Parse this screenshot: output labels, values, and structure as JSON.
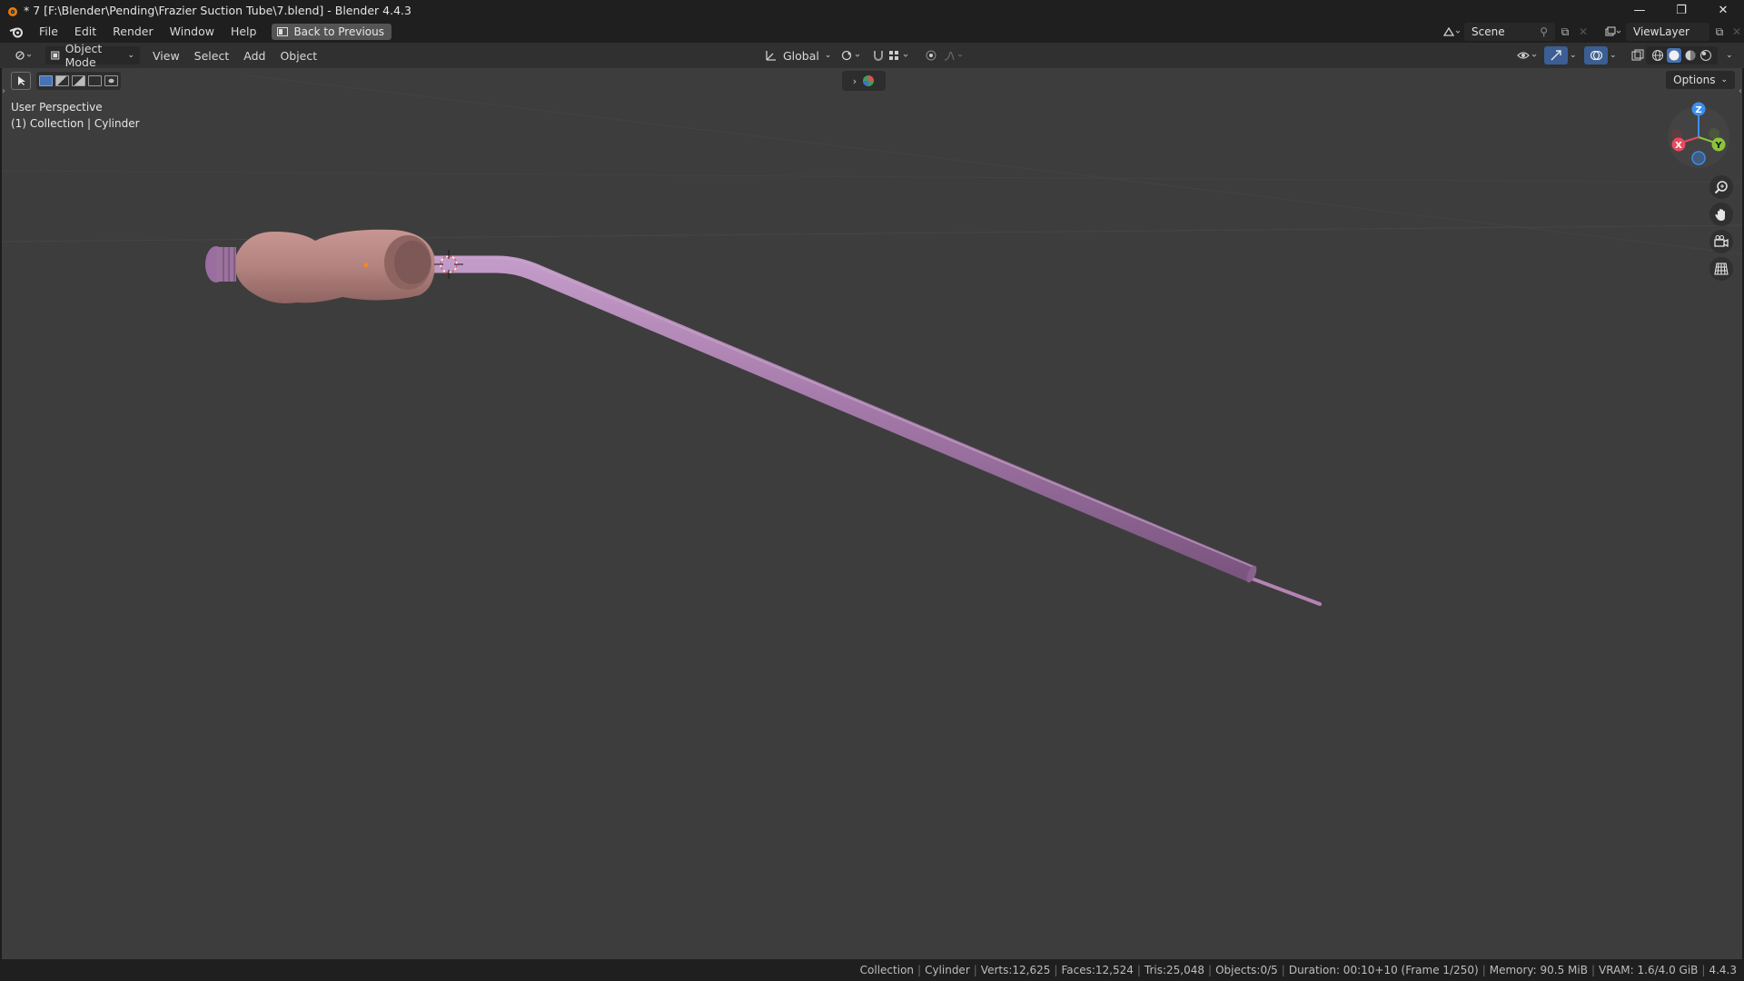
{
  "window": {
    "title": "* 7 [F:\\Blender\\Pending\\Frazier Suction Tube\\7.blend] - Blender 4.4.3",
    "controls": [
      "—",
      "❐",
      "✕"
    ]
  },
  "menubar": {
    "items": [
      "File",
      "Edit",
      "Render",
      "Window",
      "Help"
    ],
    "back_button": "Back to Previous",
    "scene_name": "Scene",
    "view_layer": "ViewLayer"
  },
  "header": {
    "mode": "Object Mode",
    "menus": [
      "View",
      "Select",
      "Add",
      "Object"
    ],
    "transform_orientation": "Global"
  },
  "viewport": {
    "perspective_label": "User Perspective",
    "collection_label": "(1) Collection | Cylinder",
    "options_label": "Options",
    "gizmo_axes": {
      "x": "X",
      "y": "Y",
      "z": "Z"
    },
    "colors": {
      "background": "#3d3d3d",
      "tube": "#a17aa6",
      "handle": "#b98886",
      "axis_x": "#e84a5e",
      "axis_y": "#8bc33a",
      "axis_z": "#3d8ff0"
    }
  },
  "statusbar": {
    "collection": "Collection",
    "object": "Cylinder",
    "verts": "Verts:12,625",
    "faces": "Faces:12,524",
    "tris": "Tris:25,048",
    "objects": "Objects:0/5",
    "duration": "Duration: 00:10+10 (Frame 1/250)",
    "memory": "Memory: 90.5 MiB",
    "vram": "VRAM: 1.6/4.0 GiB",
    "version": "4.4.3"
  }
}
